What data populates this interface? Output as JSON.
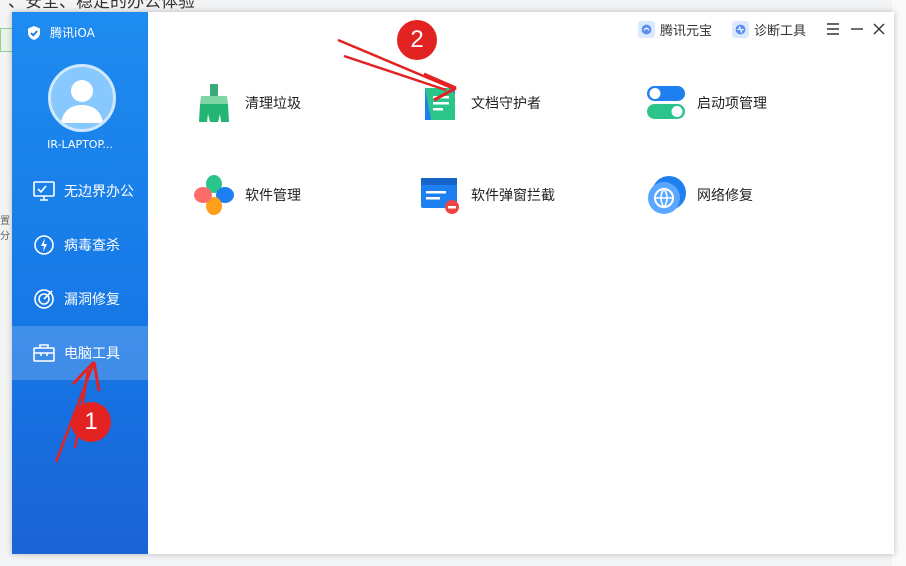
{
  "background": {
    "top_text": "、安全、稳定的办公体验",
    "left_text": "置分"
  },
  "app": {
    "brand": "腾讯iOA",
    "username": "IR-LAPTOP...",
    "title_buttons": [
      {
        "label": "腾讯元宝",
        "icon": "yuanbao-icon"
      },
      {
        "label": "诊断工具",
        "icon": "diagnose-icon"
      }
    ],
    "nav": [
      {
        "label": "无边界办公",
        "icon": "monitor-icon"
      },
      {
        "label": "病毒查杀",
        "icon": "virus-scan-icon"
      },
      {
        "label": "漏洞修复",
        "icon": "patch-icon"
      },
      {
        "label": "电脑工具",
        "icon": "toolbox-icon",
        "active": true
      }
    ],
    "tools": [
      {
        "label": "清理垃圾",
        "icon": "broom-icon"
      },
      {
        "label": "文档守护者",
        "icon": "document-guard-icon"
      },
      {
        "label": "启动项管理",
        "icon": "toggle-icon"
      },
      {
        "label": "软件管理",
        "icon": "software-clover-icon"
      },
      {
        "label": "软件弹窗拦截",
        "icon": "popup-block-icon"
      },
      {
        "label": "网络修复",
        "icon": "network-repair-icon"
      }
    ]
  },
  "annotations": [
    {
      "label": "1"
    },
    {
      "label": "2"
    }
  ],
  "colors": {
    "sidebar": "#1677e5",
    "arrow": "#e32222"
  }
}
